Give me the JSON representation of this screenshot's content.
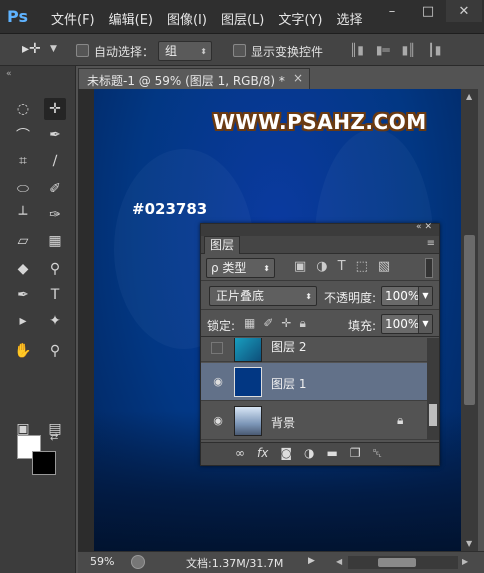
{
  "app": {
    "logo": "Ps"
  },
  "menu": [
    "文件(F)",
    "编辑(E)",
    "图像(I)",
    "图层(L)",
    "文字(Y)",
    "选择"
  ],
  "window_controls": {
    "minimize": "–",
    "restore": "□",
    "close": "✕"
  },
  "options_bar": {
    "auto_select_label": "自动选择：",
    "auto_select_value": "组",
    "show_transform_label": "显示变换控件"
  },
  "document": {
    "tab_label": "未标题-1 @ 59% (图层 1, RGB/8) *",
    "tab_close": "×",
    "watermark": "WWW.PSAHZ.COM",
    "color_note": "#023783",
    "canvas_color": "#023783"
  },
  "status": {
    "zoom": "59%",
    "doc_size": "文档:1.37M/31.7M"
  },
  "layers_panel": {
    "tab": "图层",
    "filter_label": "ρ 类型",
    "blend_mode": "正片叠底",
    "opacity_label": "不透明度:",
    "opacity_value": "100%",
    "lock_label": "锁定:",
    "fill_label": "填充:",
    "fill_value": "100%",
    "layers": [
      {
        "name": "图层 2",
        "visible": false,
        "selected": false
      },
      {
        "name": "图层 1",
        "visible": true,
        "selected": true
      },
      {
        "name": "背景",
        "visible": true,
        "selected": false,
        "locked": true
      }
    ],
    "bottom_icons": [
      "link-icon",
      "fx-icon",
      "mask-icon",
      "adjustment-icon",
      "folder-icon",
      "new-layer-icon",
      "trash-icon"
    ]
  },
  "colors": {
    "foreground": "#ffffff",
    "background": "#000000"
  }
}
